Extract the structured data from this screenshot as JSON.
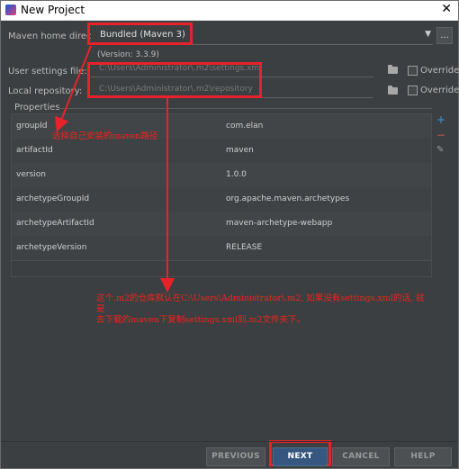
{
  "window": {
    "title": "New Project",
    "close_glyph": "✕"
  },
  "maven": {
    "home_label": "Maven home directory",
    "home_value": "Bundled (Maven 3)",
    "version": "(Version: 3.3.9)",
    "browse_label": "..."
  },
  "settings": {
    "user_settings_label": "User settings file:",
    "user_settings_value": "C:\\Users\\Administrator\\.m2\\settings.xml",
    "local_repo_label": "Local repository:",
    "local_repo_value": "C:\\Users\\Administrator\\.m2\\repository",
    "override_label": "Override"
  },
  "properties": {
    "header": "Properties",
    "add_glyph": "+",
    "remove_glyph": "−",
    "edit_glyph": "✎",
    "rows": [
      {
        "key": "groupId",
        "value": "com.elan"
      },
      {
        "key": "artifactId",
        "value": "maven"
      },
      {
        "key": "version",
        "value": "1.0.0"
      },
      {
        "key": "archetypeGroupId",
        "value": "org.apache.maven.archetypes"
      },
      {
        "key": "archetypeArtifactId",
        "value": "maven-archetype-webapp"
      },
      {
        "key": "archetypeVersion",
        "value": "RELEASE"
      }
    ]
  },
  "annotations": {
    "note1": "选择自己安装的maven路径",
    "note2_line1": "这个.m2的仓库默认在C:\\Users\\Administrator\\.m2, 如果没有settings.xml的话, 就",
    "note2_line2": "是",
    "note2_line3": "去下载的maven下复制settings.xml到.m2文件夹下。",
    "color": "#e8222a"
  },
  "buttons": {
    "previous": "PREVIOUS",
    "next": "NEXT",
    "cancel": "CANCEL",
    "help": "HELP"
  },
  "colors": {
    "background": "#3c3f41",
    "primary_button": "#365880",
    "add_icon": "#3e96d6",
    "remove_icon": "#c75450"
  },
  "icons": [
    "app-icon",
    "close-icon",
    "dropdown-arrow-icon",
    "folder-icon",
    "add-icon",
    "remove-icon",
    "edit-icon"
  ]
}
